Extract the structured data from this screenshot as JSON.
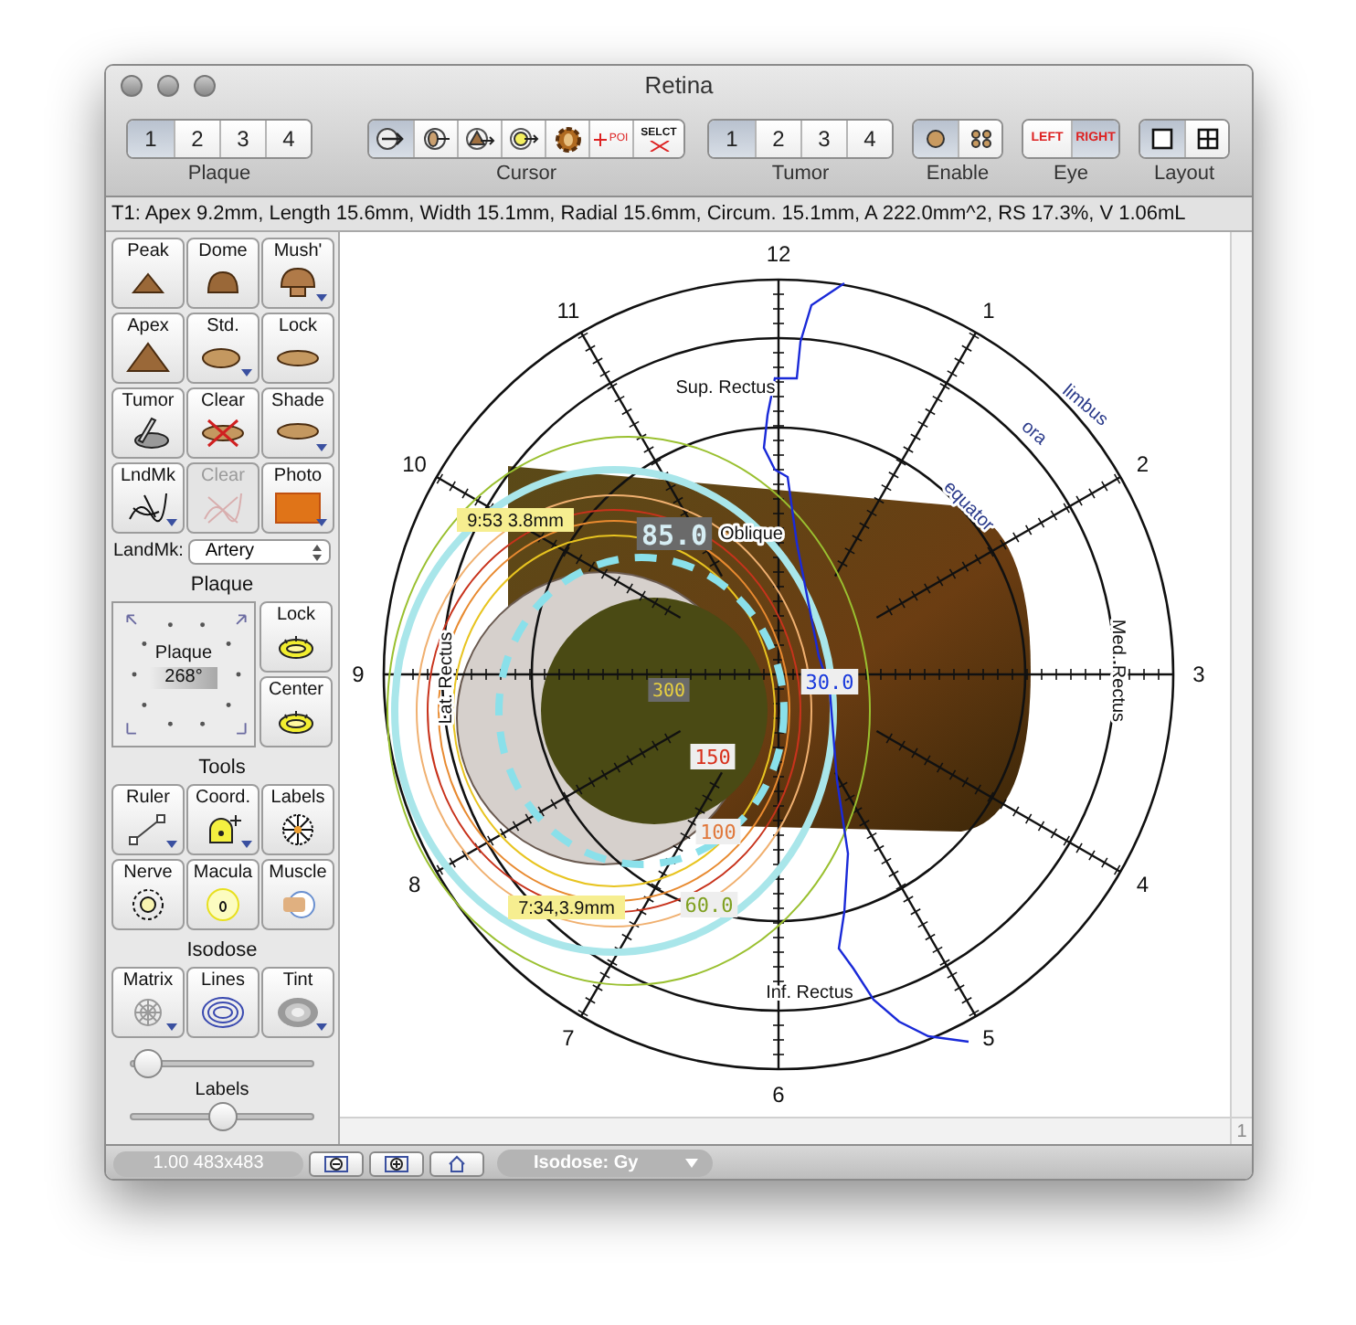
{
  "window": {
    "title": "Retina"
  },
  "toolbar": {
    "groups": [
      {
        "kind": "numbers",
        "label": "Plaque",
        "items": [
          {
            "label": "1",
            "selected": true
          },
          {
            "label": "2",
            "selected": false
          },
          {
            "label": "3",
            "selected": false
          },
          {
            "label": "4",
            "selected": false
          }
        ]
      },
      {
        "kind": "icons",
        "label": "Cursor",
        "items": [
          {
            "kind": "circle",
            "selected": true
          },
          {
            "kind": "eye",
            "selected": false
          },
          {
            "kind": "cone",
            "selected": false
          },
          {
            "kind": "dot",
            "selected": false
          },
          {
            "kind": "gear",
            "selected": false
          },
          {
            "kind": "poi",
            "text": "POI",
            "selected": false
          },
          {
            "kind": "select",
            "text": "SELCT",
            "selected": false
          }
        ]
      },
      {
        "kind": "numbers",
        "label": "Tumor",
        "items": [
          {
            "label": "1",
            "selected": true
          },
          {
            "label": "2",
            "selected": false
          },
          {
            "label": "3",
            "selected": false
          },
          {
            "label": "4",
            "selected": false
          }
        ]
      },
      {
        "kind": "icons",
        "label": "Enable",
        "items": [
          {
            "kind": "disc",
            "selected": true
          },
          {
            "kind": "discs",
            "selected": false
          }
        ]
      },
      {
        "kind": "eye",
        "label": "Eye",
        "items": [
          {
            "label": "LEFT",
            "selected": false
          },
          {
            "label": "RIGHT",
            "selected": true
          }
        ]
      },
      {
        "kind": "icons",
        "label": "Layout",
        "items": [
          {
            "kind": "single",
            "selected": true
          },
          {
            "kind": "quad",
            "selected": false
          }
        ]
      }
    ]
  },
  "info_bar": "T1: Apex 9.2mm, Length 15.6mm, Width 15.1mm, Radial 15.6mm, Circum. 15.1mm, A 222.0mm^2, RS 17.3%, V 1.06mL",
  "sidebar": {
    "shape_buttons": [
      {
        "label": "Peak",
        "kind": "peak",
        "menu": false,
        "disabled": false
      },
      {
        "label": "Dome",
        "kind": "dome",
        "menu": false,
        "disabled": false
      },
      {
        "label": "Mush'",
        "kind": "mushroom",
        "menu": true,
        "disabled": false
      },
      {
        "label": "Apex",
        "kind": "apex",
        "menu": false,
        "disabled": false
      },
      {
        "label": "Std.",
        "kind": "std",
        "menu": true,
        "disabled": false
      },
      {
        "label": "Lock",
        "kind": "lock",
        "menu": false,
        "disabled": false
      },
      {
        "label": "Tumor",
        "kind": "tumor",
        "menu": false,
        "disabled": false
      },
      {
        "label": "Clear",
        "kind": "clear",
        "menu": false,
        "disabled": false
      },
      {
        "label": "Shade",
        "kind": "shade",
        "menu": true,
        "disabled": false
      },
      {
        "label": "LndMk",
        "kind": "landmark",
        "menu": true,
        "disabled": false
      },
      {
        "label": "Clear",
        "kind": "eraser",
        "menu": false,
        "disabled": true
      },
      {
        "label": "Photo",
        "kind": "photo",
        "menu": true,
        "disabled": false
      }
    ],
    "landmark_select": {
      "label": "LandMk:",
      "value": "Artery"
    },
    "plaque_section": {
      "title": "Plaque",
      "dial": {
        "label": "Plaque",
        "angle": "268°"
      },
      "buttons": [
        {
          "label": "Lock",
          "kind": "ring"
        },
        {
          "label": "Center",
          "kind": "ring"
        }
      ]
    },
    "tools_section": {
      "title": "Tools",
      "buttons": [
        {
          "label": "Ruler",
          "kind": "ruler",
          "menu": true,
          "disabled": false
        },
        {
          "label": "Coord.",
          "kind": "coord",
          "menu": true,
          "disabled": false
        },
        {
          "label": "Labels",
          "kind": "labels",
          "menu": false,
          "disabled": false
        },
        {
          "label": "Nerve",
          "kind": "nerve",
          "menu": false,
          "disabled": false
        },
        {
          "label": "Macula",
          "kind": "macula",
          "menu": false,
          "disabled": false
        },
        {
          "label": "Muscle",
          "kind": "muscle",
          "menu": false,
          "disabled": false
        }
      ]
    },
    "isodose_section": {
      "title": "Isodose",
      "buttons": [
        {
          "label": "Matrix",
          "kind": "matrix",
          "menu": true,
          "disabled": false
        },
        {
          "label": "Lines",
          "kind": "lines",
          "menu": false,
          "disabled": false
        },
        {
          "label": "Tint",
          "kind": "tint",
          "menu": true,
          "disabled": false
        }
      ],
      "sliders": [
        {
          "level": 0.1
        },
        {
          "label": "Labels",
          "level": 0.5
        }
      ]
    }
  },
  "diagram": {
    "clock_labels": [
      "1",
      "2",
      "3",
      "4",
      "5",
      "6",
      "7",
      "8",
      "9",
      "10",
      "11",
      "12"
    ],
    "structure_labels": [
      {
        "kind": "sup",
        "text": "Sup. Rectus"
      },
      {
        "kind": "limbus",
        "text": "limbus"
      },
      {
        "kind": "ora",
        "text": "ora"
      },
      {
        "kind": "equator",
        "text": "equator"
      },
      {
        "kind": "oblique",
        "text": "Oblique"
      },
      {
        "kind": "lat",
        "text": "Lat. Rectus"
      },
      {
        "kind": "med",
        "text": "Med. Rectus"
      },
      {
        "kind": "inf",
        "text": "Inf. Rectus"
      }
    ],
    "dose_labels": [
      {
        "text": "85.0",
        "color": "#d6eef4"
      },
      {
        "text": "300",
        "color": "#e8d040"
      },
      {
        "text": "30.0",
        "color": "#1a3adc"
      },
      {
        "text": "150",
        "color": "#d8301c"
      },
      {
        "text": "100",
        "color": "#e0783c"
      },
      {
        "text": "60.0",
        "color": "#7fa020"
      }
    ],
    "measurements": [
      "9:53 3.8mm",
      "7:34,3.9mm"
    ],
    "corner_label": "1"
  },
  "status_bar": {
    "zoom": "1.00 483x483",
    "isodose_menu": "Isodose: Gy"
  }
}
